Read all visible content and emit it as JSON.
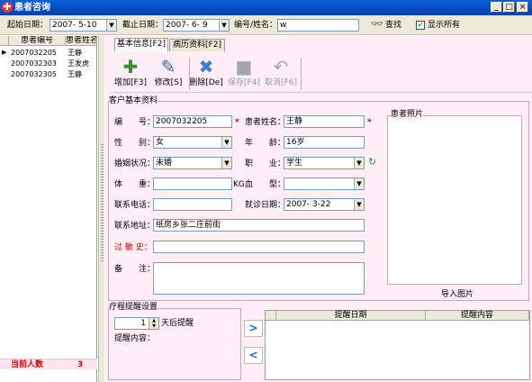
{
  "window": {
    "title": "患者咨询",
    "minimize": "_",
    "maximize": "□",
    "close": "×"
  },
  "filter": {
    "start_label": "起始日期：",
    "start_value": "2007- 5-10",
    "end_label": "截止日期：",
    "end_value": "2007- 6- 9",
    "id_label": "编号/姓名：",
    "id_value": "w",
    "search_label": "查找",
    "show_all_label": "显示所有",
    "show_all_checked": "✔"
  },
  "list": {
    "columns": [
      "患者编号",
      "患者姓名"
    ],
    "rows": [
      {
        "id": "2007032205",
        "name": "王静"
      },
      {
        "id": "2007032303",
        "name": "王发虎"
      },
      {
        "id": "2007032305",
        "name": "王静"
      }
    ],
    "current_marker": "▶",
    "footer_label": "当前人数",
    "footer_count": "3"
  },
  "tabs": [
    "基本信息[F2]",
    "病历资料[F2]"
  ],
  "toolbar": {
    "add": "增加[F3]",
    "edit": "修改[S]",
    "delete": "删除[De]",
    "save": "保存[F4]",
    "cancel": "取消[F6]"
  },
  "basic": {
    "group_title": "客户基本资料",
    "id_label": "编　　号：",
    "id_value": "2007032205",
    "name_label": "患者姓名：",
    "name_value": "王静",
    "gender_label": "性　　别：",
    "gender_value": "女",
    "age_label": "年　　龄：",
    "age_value": "16岁",
    "marital_label": "婚姻状况：",
    "marital_value": "未婚",
    "job_label": "职　　业：",
    "job_value": "学生",
    "weight_label": "体　　重：",
    "weight_value": "",
    "weight_unit": "KG",
    "blood_label": "血　　型：",
    "blood_value": "",
    "phone_label": "联系电话：",
    "phone_value": "",
    "visit_label": "就诊日期：",
    "visit_value": "2007- 3-22",
    "address_label": "联系地址：",
    "address_value": "纸房乡张二庄前街",
    "allergy_label": "过 敏 史：",
    "allergy_value": "",
    "remark_label": "备　　注：",
    "remark_value": "",
    "required_mark": "*"
  },
  "photo": {
    "title": "患者照片",
    "import": "导入图片"
  },
  "reminder": {
    "group_title": "疗程提醒设置",
    "days_value": "1",
    "days_suffix": "天后提醒",
    "content_label": "提醒内容：",
    "columns": [
      "提醒日期",
      "提醒内容"
    ],
    "add_arrow": ">",
    "remove_arrow": "<"
  },
  "colors": {
    "title_bar": "#0a4fc8",
    "panel_bg": "#ffeef6",
    "accent_red": "#e00000",
    "arrow_blue": "#1a5fd0"
  }
}
